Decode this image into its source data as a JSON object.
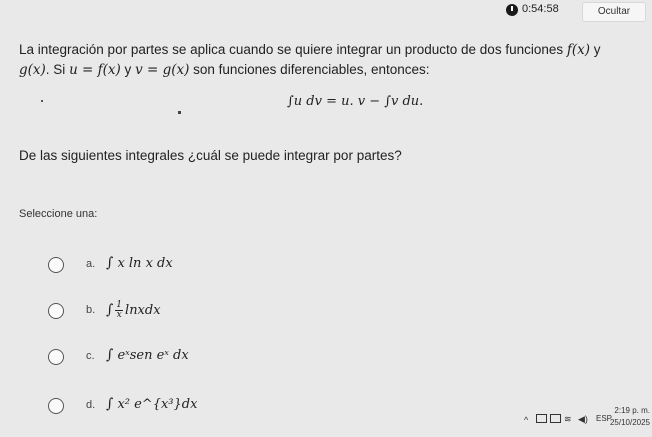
{
  "header": {
    "timer": "0:54:58",
    "hide_label": "Ocultar"
  },
  "question": {
    "intro_part1": "La integración por partes se aplica cuando se quiere integrar un producto de dos funciones ",
    "f_x": "f(x)",
    "intro_y": " y",
    "g_x": "g(x)",
    "intro_part2": ". Si ",
    "u_eq": "u = f(x)",
    "y": " y ",
    "v_eq": "v = g(x)",
    "intro_part3": " son funciones diferenciables, entonces:",
    "formula": "∫u dv = u. v − ∫v du.",
    "question_text": "De las siguientes integrales ¿cuál se puede integrar por partes?",
    "prompt": "Seleccione una:"
  },
  "options": [
    {
      "letter": "a.",
      "expr": "x ln x dx"
    },
    {
      "letter": "b.",
      "num": "1",
      "den": "x",
      "expr": "lnxdx"
    },
    {
      "letter": "c.",
      "expr": "eˣsen eˣ dx"
    },
    {
      "letter": "d.",
      "expr": "x² e^{x³}dx"
    }
  ],
  "taskbar": {
    "lang": "ESP",
    "time": "2:19 p. m.",
    "date": "25/10/2025"
  }
}
